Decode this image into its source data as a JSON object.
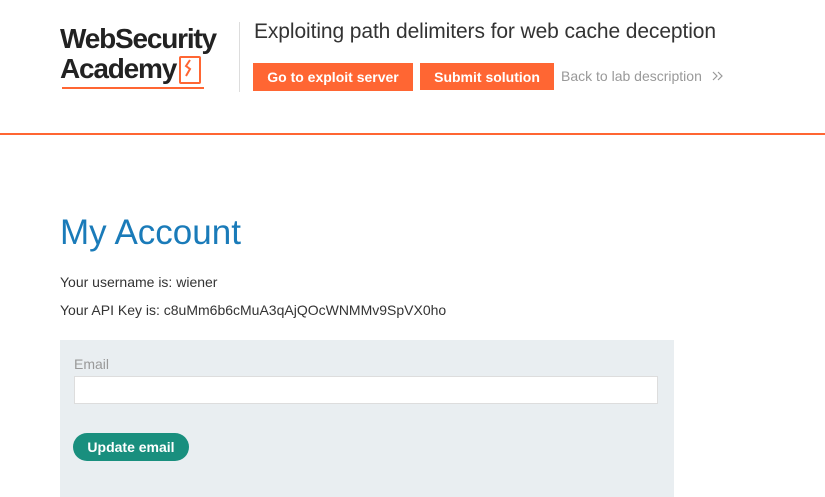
{
  "header": {
    "logo": {
      "line1": "WebSecurity",
      "line2": "Academy",
      "icon": "lightning-bolt-icon",
      "accent_color": "#ff6633"
    },
    "lab_title": "Exploiting path delimiters for web cache deception",
    "exploit_server_label": "Go to exploit server",
    "submit_solution_label": "Submit solution",
    "back_label": "Back to lab description",
    "back_icon": "double-chevron-right-icon"
  },
  "main": {
    "title": "My Account",
    "username_prefix": "Your username is: ",
    "username": "wiener",
    "apikey_prefix": "Your API Key is: ",
    "apikey": "c8uMm6b6cMuA3qAjQOcWNMMv9SpVX0ho"
  },
  "form": {
    "email_label": "Email",
    "email_value": "",
    "update_label": "Update email"
  },
  "colors": {
    "accent_orange": "#ff6633",
    "title_blue": "#1a7bb9",
    "button_teal": "#198f7e",
    "panel_bg": "#e9eef1"
  }
}
